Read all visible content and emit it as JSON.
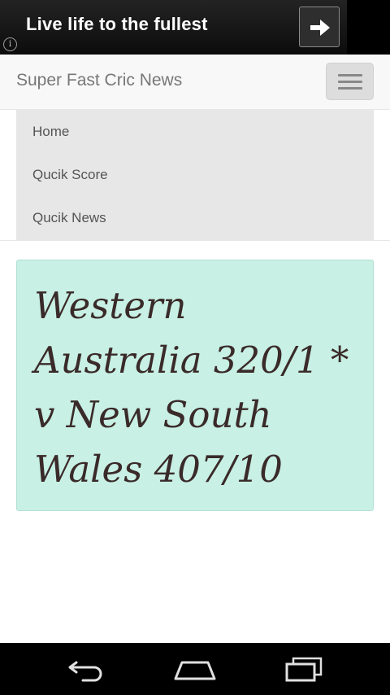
{
  "ad": {
    "text": "Live life to the fullest",
    "info_glyph": "i",
    "info_icon": "info-icon",
    "action_icon": "arrow-right-icon"
  },
  "navbar": {
    "brand": "Super Fast Cric News",
    "toggle_icon": "hamburger-menu-icon"
  },
  "menu": {
    "items": [
      {
        "label": "Home"
      },
      {
        "label": "Qucik Score"
      },
      {
        "label": "Qucik News"
      }
    ]
  },
  "score": {
    "text": "Western Australia 320/1 * v New South Wales 407/10"
  },
  "system_nav": {
    "back_icon": "back-icon",
    "home_icon": "home-icon",
    "recents_icon": "recent-apps-icon"
  },
  "colors": {
    "ad_background": "#000000",
    "navbar_background": "#f8f8f8",
    "menu_background": "#e7e7e7",
    "score_background": "#c8f0e4",
    "score_text": "#3a2a2a"
  }
}
